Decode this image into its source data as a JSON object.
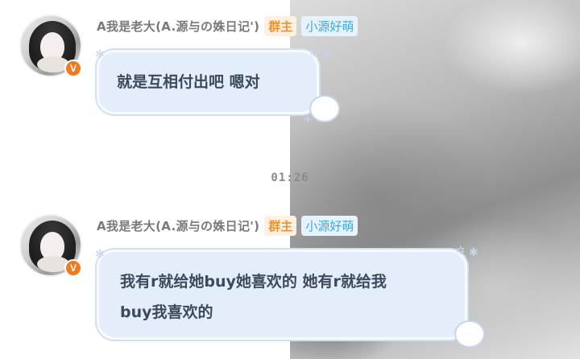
{
  "messages": [
    {
      "sender": "A我是老大(A.源与の姝日记')",
      "role_badge": "群主",
      "title_badge": "小源好萌",
      "text": "就是互相付出吧  嗯对",
      "avatar_badge": "V"
    },
    {
      "sender": "A我是老大(A.源与の姝日记')",
      "role_badge": "群主",
      "title_badge": "小源好萌",
      "text_line1": "我有r就给她buy她喜欢的  她有r就给我",
      "text_line2": "buy我喜欢的",
      "avatar_badge": "V"
    }
  ],
  "timestamp": "01:26",
  "colors": {
    "owner_badge": "#f2922a",
    "title_badge": "#3fa6dc",
    "bubble": "#e4eefb",
    "vip_badge": "#f07b1f"
  }
}
